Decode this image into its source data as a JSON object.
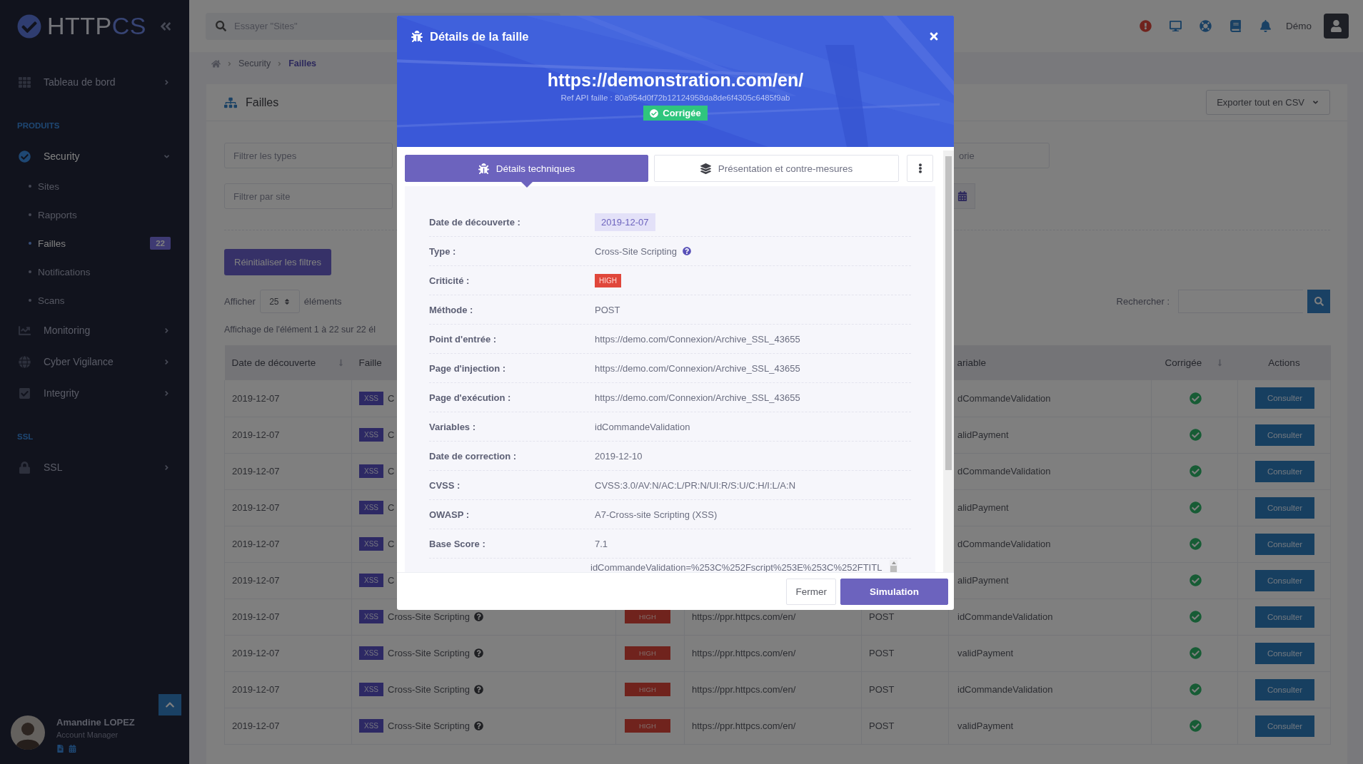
{
  "sidebar": {
    "logo": {
      "part_1": "HTTP",
      "part_2": "CS"
    },
    "menu": [
      {
        "kind": "item",
        "label": "Tableau de bord",
        "expanded": false
      },
      {
        "kind": "heading",
        "label": "PRODUITS"
      },
      {
        "kind": "item",
        "label": "Security",
        "expanded": true,
        "children": [
          {
            "label": "Sites",
            "selected": false
          },
          {
            "label": "Rapports",
            "selected": false
          },
          {
            "label": "Failles",
            "selected": true,
            "badge": "22"
          },
          {
            "label": "Notifications",
            "selected": false
          },
          {
            "label": "Scans",
            "selected": false
          }
        ]
      },
      {
        "kind": "item",
        "label": "Monitoring",
        "expanded": false
      },
      {
        "kind": "item",
        "label": "Cyber Vigilance",
        "expanded": false
      },
      {
        "kind": "item",
        "label": "Integrity",
        "expanded": false
      },
      {
        "kind": "heading",
        "label": "SSL"
      },
      {
        "kind": "item",
        "label": "SSL",
        "expanded": false
      }
    ],
    "user": {
      "name": "Amandine LOPEZ",
      "role": "Account Manager"
    }
  },
  "topbar": {
    "search": {
      "placeholder": "Essayer \"Sites\""
    },
    "user": "Démo"
  },
  "breadcrumb": [
    "Security",
    "Failles"
  ],
  "page": {
    "title": "Failles",
    "export_button": "Exporter tout en CSV",
    "filters": [
      {
        "placeholder": "Filtrer les types"
      },
      {
        "placeholder": "Filtrer par site"
      },
      {
        "placeholder": "orie"
      }
    ],
    "reset_button": "Réinitialiser les filtres",
    "length": {
      "prefix": "Afficher",
      "value": "25",
      "suffix": "éléments"
    },
    "search_label": "Rechercher :",
    "info": "Affichage de l'élément 1 à 22 sur 22 él"
  },
  "table": {
    "columns": [
      {
        "label": "Date de découverte",
        "sortable": true
      },
      {
        "label": "Faille"
      },
      {
        "label": "ariable",
        "sortable": false
      },
      {
        "label": "Corrigée",
        "sortable": true
      },
      {
        "label": "Actions",
        "sortable": false
      }
    ],
    "rows": [
      {
        "date": "2019-12-07",
        "tag": "XSS",
        "faille": "C",
        "variable": "dCommandeValidation",
        "corrected": true,
        "action": "Consulter"
      },
      {
        "date": "2019-12-07",
        "tag": "XSS",
        "faille": "C",
        "variable": "alidPayment",
        "corrected": true,
        "action": "Consulter"
      },
      {
        "date": "2019-12-07",
        "tag": "XSS",
        "faille": "C",
        "variable": "dCommandeValidation",
        "corrected": true,
        "action": "Consulter"
      },
      {
        "date": "2019-12-07",
        "tag": "XSS",
        "faille": "C",
        "variable": "alidPayment",
        "corrected": true,
        "action": "Consulter"
      },
      {
        "date": "2019-12-07",
        "tag": "XSS",
        "faille": "C",
        "variable": "dCommandeValidation",
        "corrected": true,
        "action": "Consulter"
      },
      {
        "date": "2019-12-07",
        "tag": "XSS",
        "faille": "C",
        "variable": "alidPayment",
        "corrected": true,
        "action": "Consulter"
      },
      {
        "date": "2019-12-07",
        "tag": "XSS",
        "faille": "Cross-Site Scripting",
        "help": true,
        "criticity": "HIGH",
        "url": "https://ppr.httpcs.com/en/",
        "method": "POST",
        "variable": "idCommandeValidation",
        "corrected": true,
        "action": "Consulter"
      },
      {
        "date": "2019-12-07",
        "tag": "XSS",
        "faille": "Cross-Site Scripting",
        "help": true,
        "criticity": "HIGH",
        "url": "https://ppr.httpcs.com/en/",
        "method": "POST",
        "variable": "validPayment",
        "corrected": true,
        "action": "Consulter"
      },
      {
        "date": "2019-12-07",
        "tag": "XSS",
        "faille": "Cross-Site Scripting",
        "help": true,
        "criticity": "HIGH",
        "url": "https://ppr.httpcs.com/en/",
        "method": "POST",
        "variable": "idCommandeValidation",
        "corrected": true,
        "action": "Consulter"
      },
      {
        "date": "2019-12-07",
        "tag": "XSS",
        "faille": "Cross-Site Scripting",
        "help": true,
        "criticity": "HIGH",
        "url": "https://ppr.httpcs.com/en/",
        "method": "POST",
        "variable": "validPayment",
        "corrected": true,
        "action": "Consulter"
      }
    ]
  },
  "modal": {
    "title": "Détails de la faille",
    "url": "https://demonstration.com/en/",
    "ref": "Ref API faille : 80a954d0f72b12124958da8de6f4305c6485f9ab",
    "status": "Corrigée",
    "tabs": [
      {
        "label": "Détails techniques",
        "selected": true
      },
      {
        "label": "Présentation et contre-mesures",
        "selected": false
      }
    ],
    "details": [
      {
        "kind": "chip",
        "label": "Date de découverte :",
        "value": "2019-12-07"
      },
      {
        "kind": "help",
        "label": "Type :",
        "value": "Cross-Site Scripting"
      },
      {
        "kind": "badge",
        "label": "Criticité :",
        "value": "HIGH"
      },
      {
        "kind": "text",
        "label": "Méthode :",
        "value": "POST"
      },
      {
        "kind": "text",
        "label": "Point d'entrée :",
        "value": "https://demo.com/Connexion/Archive_SSL_43655"
      },
      {
        "kind": "text",
        "label": "Page d'injection :",
        "value": "https://demo.com/Connexion/Archive_SSL_43655"
      },
      {
        "kind": "text",
        "label": "Page d'exécution :",
        "value": "https://demo.com/Connexion/Archive_SSL_43655"
      },
      {
        "kind": "text",
        "label": "Variables :",
        "value": "idCommandeValidation"
      },
      {
        "kind": "text",
        "label": "Date de correction :",
        "value": "2019-12-10"
      },
      {
        "kind": "text",
        "label": "CVSS :",
        "value": "CVSS:3.0/AV:N/AC:L/PR:N/UI:R/S:U/C:H/I:L/A:N"
      },
      {
        "kind": "text",
        "label": "OWASP :",
        "value": "A7-Cross-site Scripting (XSS)"
      },
      {
        "kind": "text",
        "label": "Base Score :",
        "value": "7.1"
      },
      {
        "kind": "code",
        "value": "idCommandeValidation=%253C%252Fscript%253E%253C%252FTITL"
      }
    ],
    "buttons": [
      {
        "label": "Fermer",
        "kind": "secondary"
      },
      {
        "label": "Simulation",
        "kind": "primary"
      }
    ]
  }
}
